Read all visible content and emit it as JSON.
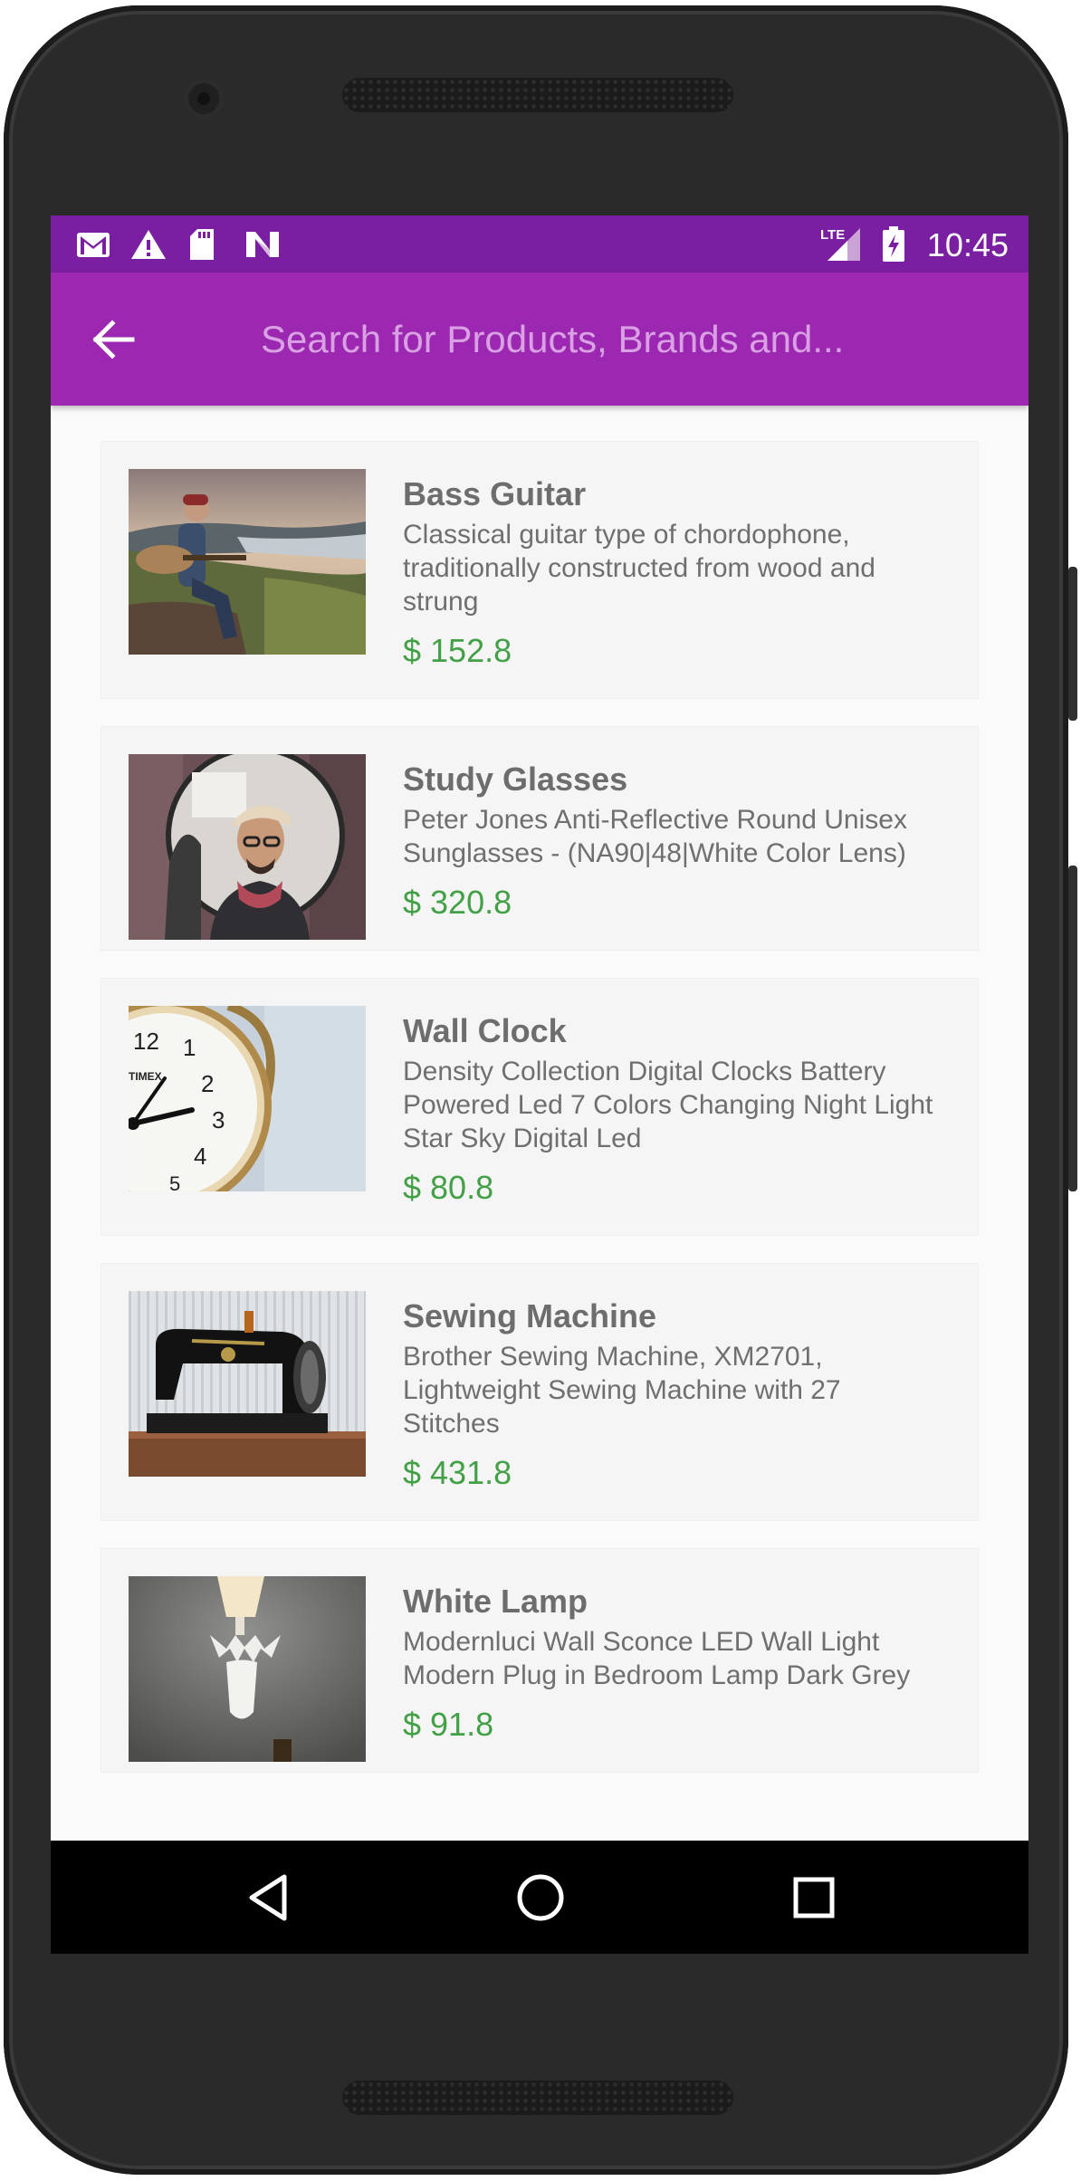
{
  "status_bar": {
    "time": "10:45",
    "network": "LTE"
  },
  "app_bar": {
    "search_placeholder": "Search for Products, Brands and..."
  },
  "colors": {
    "status_bar": "#7b1fa2",
    "app_bar": "#9c27b0",
    "price": "#43a047",
    "title": "#6d6d6d"
  },
  "products": [
    {
      "title": "Bass Guitar",
      "description": "Classical guitar  type of chordophone, traditionally constructed from wood and strung",
      "price": "$ 152.8"
    },
    {
      "title": "Study Glasses",
      "description": "Peter Jones Anti-Reflective Round Unisex Sunglasses - (NA90|48|White Color Lens)",
      "price": "$ 320.8"
    },
    {
      "title": "Wall Clock",
      "description": "Density Collection Digital Clocks Battery Powered Led 7 Colors Changing Night Light Star Sky Digital Led",
      "price": "$ 80.8"
    },
    {
      "title": "Sewing Machine",
      "description": "Brother Sewing Machine, XM2701, Lightweight Sewing Machine with 27 Stitches",
      "price": "$ 431.8"
    },
    {
      "title": "White Lamp",
      "description": "Modernluci Wall Sconce LED Wall Light Modern Plug in Bedroom Lamp Dark Grey",
      "price": "$ 91.8"
    }
  ],
  "clock_image": {
    "brand": "TIMEX",
    "numerals": [
      "12",
      "1",
      "2",
      "3",
      "4",
      "5"
    ]
  }
}
